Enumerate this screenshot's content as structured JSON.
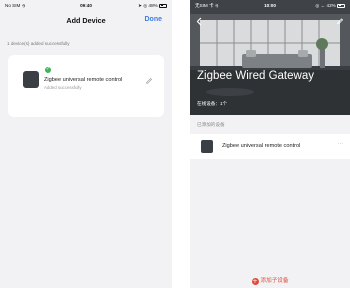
{
  "left_screen": {
    "status_bar": {
      "carrier": "No SIM ⨵",
      "time": "09:40",
      "battery": "➤ ◎ 48%"
    },
    "title": "Add Device",
    "done_label": "Done",
    "notice": "1 device(s) added successfully",
    "device": {
      "name": "Zigbee universal remote control",
      "status": "Added successfully",
      "check_glyph": "✓",
      "icon": "edit-pencil-icon"
    }
  },
  "right_screen": {
    "status_bar": {
      "carrier": "无SIM 卡 ⨵",
      "time": "10:00",
      "battery": "◎ ← 42%"
    },
    "gateway_name": "Zigbee Wired Gateway",
    "online_devices": "在线设备：1个",
    "section_title": "已添加的设备",
    "sub_device_name": "Zigbee universal remote control",
    "more_glyph": "···",
    "add_plus": "+",
    "add_label": "添加子设备",
    "icons": [
      "back-icon",
      "edit-icon",
      "more-icon",
      "add-icon"
    ]
  }
}
